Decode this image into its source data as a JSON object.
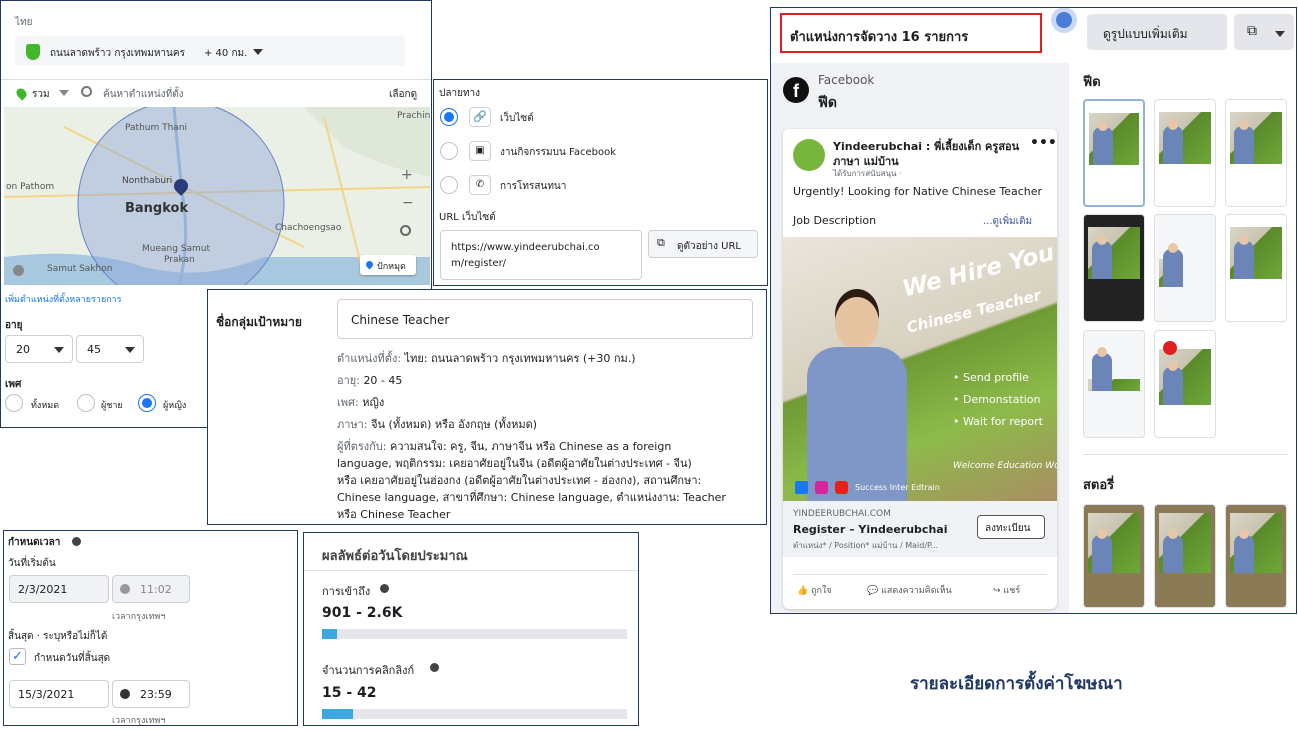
{
  "map_panel": {
    "country": "ไทย",
    "location": "ถนนลาดพร้าว กรุงเทพมหานคร",
    "radius": "+ 40 กม.",
    "filter": "รวม",
    "search_placeholder": "ค้นหาตำแหน่งที่ตั้ง",
    "browse": "เลือกดู",
    "places": [
      "Prachin Bu",
      "Pathum Thani",
      "Nonthaburi",
      "on Pathom",
      "Bangkok",
      "Chachoengsao",
      "Mueang Samut",
      "Prakan",
      "Samut Sakhon"
    ],
    "pin_label": "ปักหมุด",
    "add_multiple": "เพิ่มตำแหน่งที่ตั้งหลายรายการ",
    "age_label": "อายุ",
    "age_min": "20",
    "age_max": "45",
    "gender_label": "เพศ",
    "gender_options": [
      "ทั้งหมด",
      "ผู้ชาย",
      "ผู้หญิง"
    ]
  },
  "destination": {
    "title": "ปลายทาง",
    "options": [
      "เว็บไซต์",
      "งานกิจกรรมบน Facebook",
      "การโทรสนทนา"
    ],
    "url_label": "URL เว็บไซต์",
    "url_value": "https://www.yindeerubchai.com/register/",
    "url_line1": "https://www.yindeerubchai.co",
    "url_line2": "m/register/",
    "preview_button": "ดูตัวอย่าง URL"
  },
  "audience": {
    "name_label": "ชื่อกลุ่มเป้าหมาย",
    "name_value": "Chinese Teacher",
    "loc_key": "ตำแหน่งที่ตั้ง:",
    "loc_val": "ไทย: ถนนลาดพร้าว กรุงเทพมหานคร (+30 กม.)",
    "age_key": "อายุ:",
    "age_val": "20 - 45",
    "gender_key": "เพศ:",
    "gender_val": "หญิง",
    "lang_key": "ภาษา:",
    "lang_val": "จีน (ทั้งหมด) หรือ อังกฤษ (ทั้งหมด)",
    "people_key": "ผู้ที่ตรงกับ:",
    "people_lines": [
      "ความสนใจ: ครู, จีน, ภาษาจีน หรือ Chinese as a foreign",
      "language, พฤติกรรม: เคยอาศัยอยู่ในจีน (อดีตผู้อาศัยในต่างประเทศ - จีน)",
      "หรือ เคยอาศัยอยู่ในฮ่องกง (อดีตผู้อาศัยในต่างประเทศ - ฮ่องกง), สถานศึกษา:",
      "Chinese language, สาขาที่ศึกษา: Chinese language, ตำแหน่งงาน: Teacher",
      "หรือ Chinese Teacher"
    ]
  },
  "schedule": {
    "title": "กำหนดเวลา",
    "start_label": "วันที่เริ่มต้น",
    "start_date": "2/3/2021",
    "start_time": "11:02",
    "timezone": "เวลากรุงเทพฯ",
    "end_label": "สิ้นสุด · ระบุหรือไม่ก็ได้",
    "end_checkbox": "กำหนดวันที่สิ้นสุด",
    "end_date": "15/3/2021",
    "end_time": "23:59"
  },
  "results": {
    "title": "ผลลัพธ์ต่อวันโดยประมาณ",
    "reach_label": "การเข้าถึง",
    "reach_value": "901 - 2.6K",
    "reach_fill": 0.05,
    "clicks_label": "จำนวนการคลิกลิงก์",
    "clicks_value": "15 - 42",
    "clicks_fill": 0.1
  },
  "preview": {
    "placements_title": "ตำแหน่งการจัดวาง 16 รายการ",
    "more_templates": "ดูรูปแบบเพิ่มเติม",
    "platform": "Facebook",
    "placement": "ฟีด",
    "page_name_1": "Yindeerubchai : พี่เลี้ยงเด็ก ครูสอน",
    "page_name_2": "ภาษา แม่บ้าน",
    "sponsored": "ได้รับการสนับสนุน ·",
    "ad_text": "Urgently! Looking for Native Chinese Teacher",
    "job_desc": "Job Description",
    "see_more": "...ดูเพิ่มเติม",
    "hero_1": "We Hire You",
    "hero_2": "Chinese Teacher",
    "bullets": [
      "Send profile",
      "Demonstation",
      "Wait for report"
    ],
    "welcome": "Welcome Education World",
    "footer_brand": "Success Inter Edtrain",
    "domain": "YINDEERUBCHAI.COM",
    "headline": "Register – Yindeerubchai",
    "description": "ตำแหน่ง* / Position* แม่บ้าน / Maid/P...",
    "cta": "ลงทะเบียน",
    "actions": [
      "ถูกใจ",
      "แสดงความคิดเห็น",
      "แชร์"
    ],
    "feed_section": "ฟีด",
    "stories_section": "สตอรี่"
  },
  "caption": "รายละเอียดการตั้งค่าโฆษณา",
  "colors": {
    "accent": "#1877f2",
    "border": "#1f3864",
    "highlight": "#e02020",
    "caption": "#1f3864",
    "bar": "#3da7e0"
  }
}
